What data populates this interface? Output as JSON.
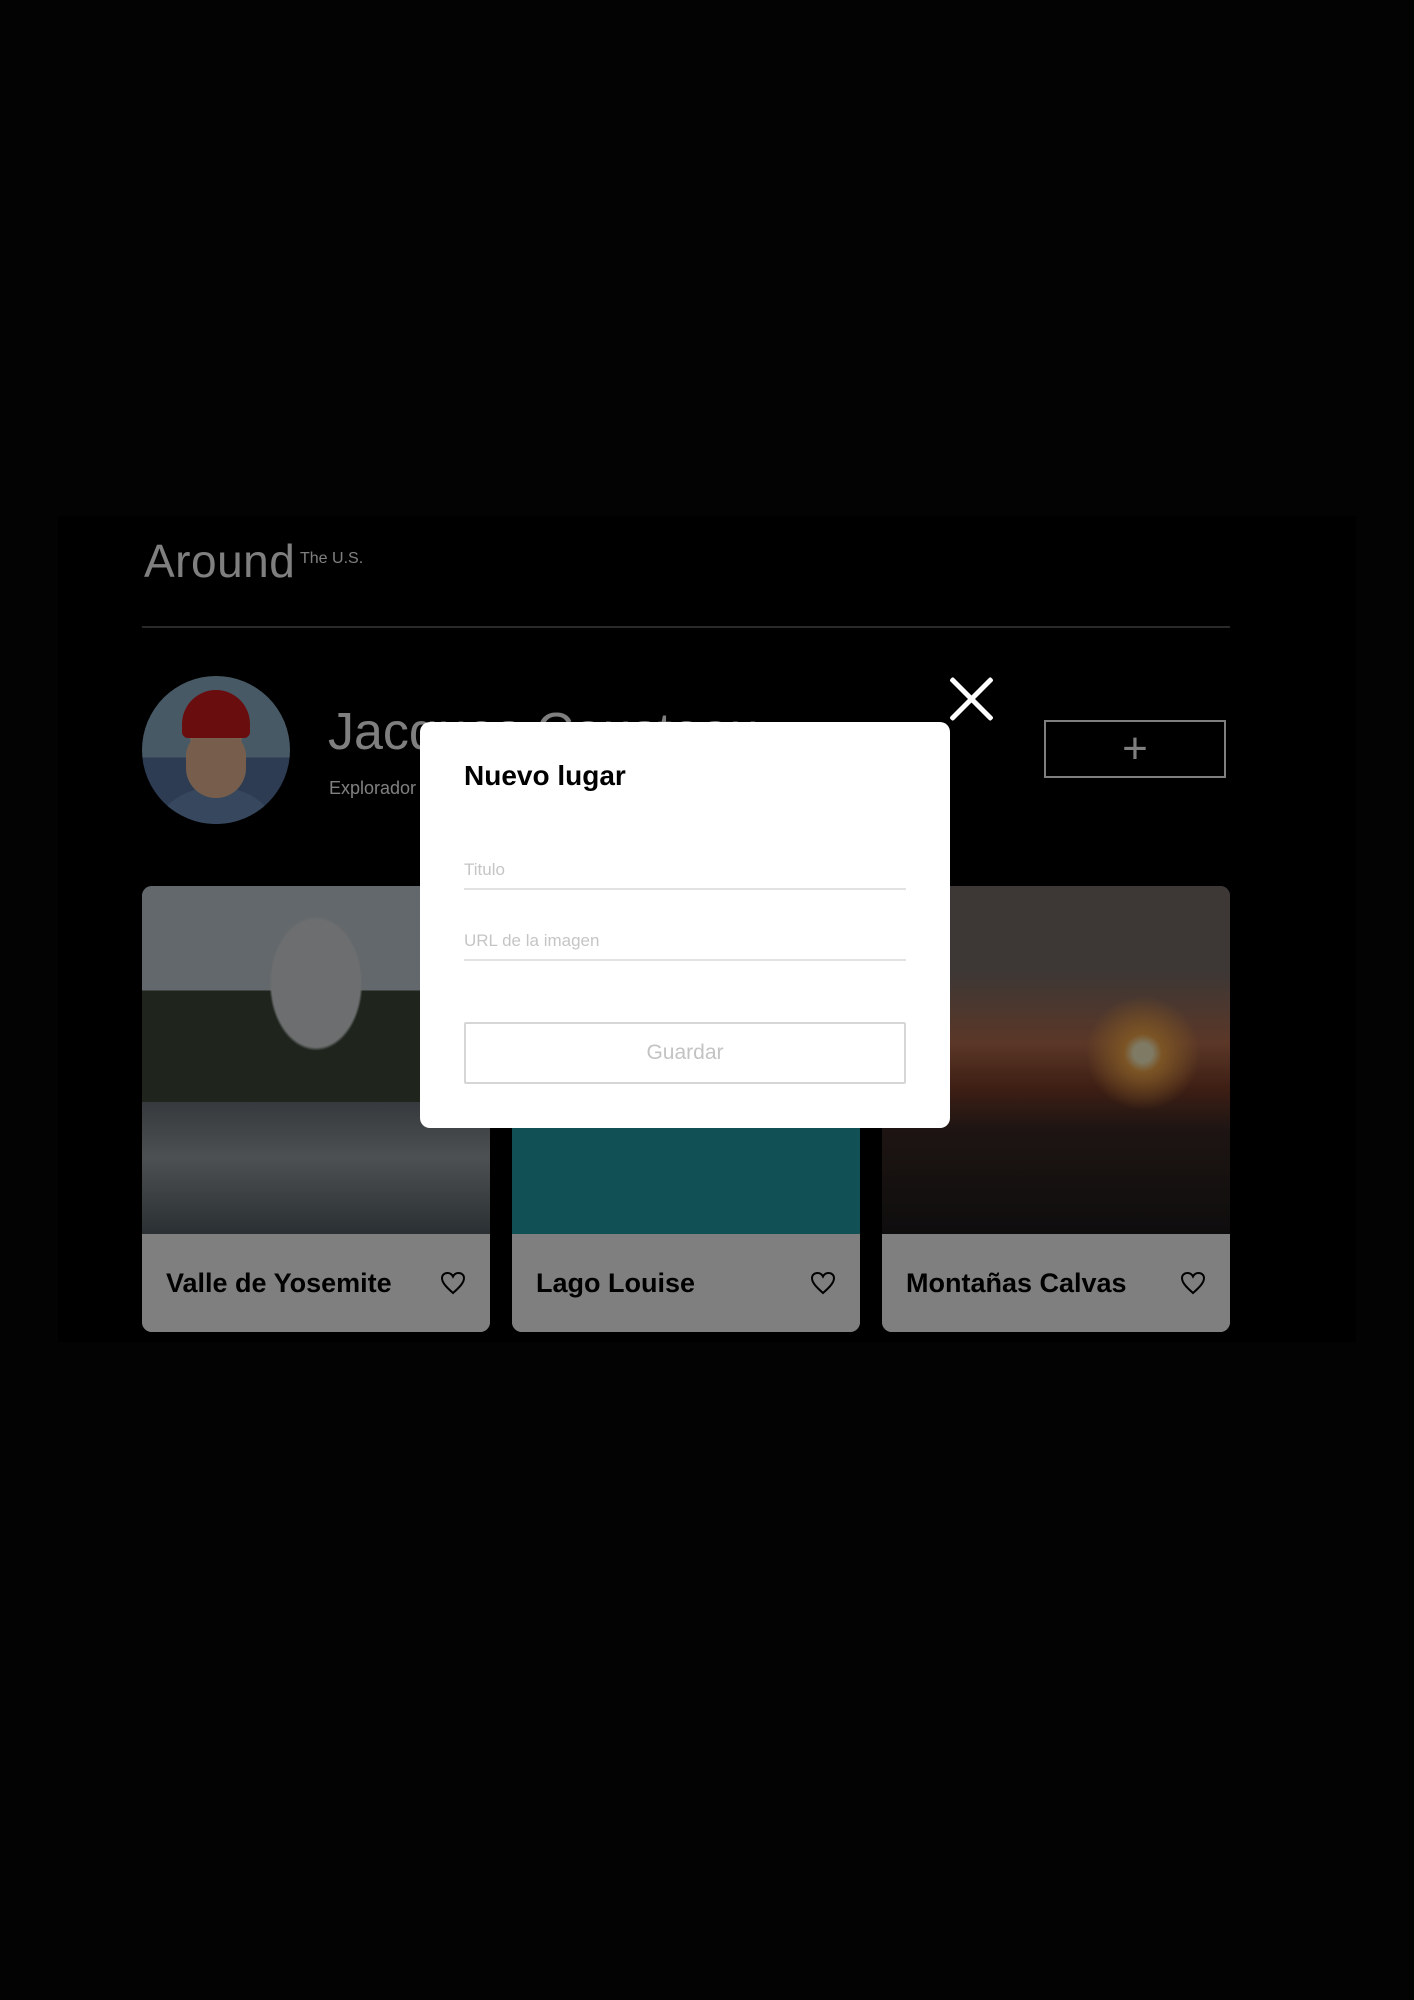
{
  "header": {
    "logo": "Around",
    "logo_superscript": "The U.S."
  },
  "profile": {
    "name": "Jacques Cousteau",
    "about": "Explorador"
  },
  "add_button_label": "+",
  "cards": [
    {
      "title": "Valle de Yosemite",
      "liked": false
    },
    {
      "title": "Lago Louise",
      "liked": false
    },
    {
      "title": "Montañas Calvas",
      "liked": false
    }
  ],
  "modal": {
    "title": "Nuevo lugar",
    "title_placeholder": "Titulo",
    "url_placeholder": "URL de la imagen",
    "submit_label": "Guardar"
  }
}
